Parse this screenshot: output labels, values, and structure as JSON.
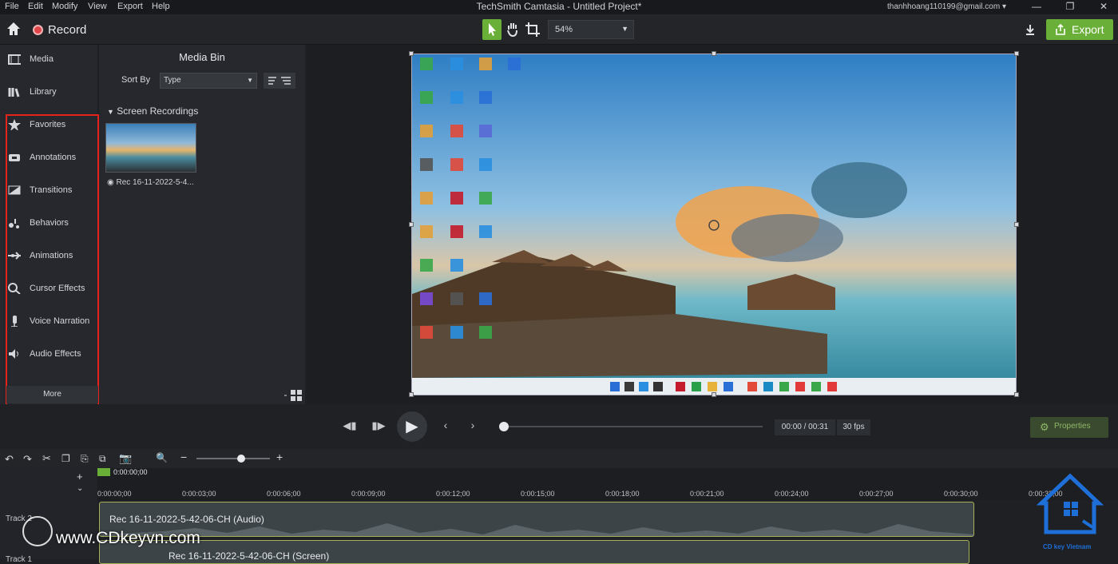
{
  "menubar": {
    "items": [
      "File",
      "Edit",
      "Modify",
      "View",
      "Export",
      "Help"
    ],
    "window_title": "TechSmith Camtasia - Untitled Project*",
    "account": "thanhhoang110199@gmail.com ▾"
  },
  "toolbar": {
    "record_label": "Record",
    "zoom_value": "54%",
    "export_label": "Export"
  },
  "leftnav": {
    "items": [
      {
        "label": "Media",
        "icon": "film-icon"
      },
      {
        "label": "Library",
        "icon": "library-icon"
      },
      {
        "label": "Favorites",
        "icon": "star-icon"
      },
      {
        "label": "Annotations",
        "icon": "annotation-icon"
      },
      {
        "label": "Transitions",
        "icon": "transition-icon"
      },
      {
        "label": "Behaviors",
        "icon": "behavior-icon"
      },
      {
        "label": "Animations",
        "icon": "animation-icon"
      },
      {
        "label": "Cursor Effects",
        "icon": "cursor-icon"
      },
      {
        "label": "Voice Narration",
        "icon": "microphone-icon"
      },
      {
        "label": "Audio Effects",
        "icon": "speaker-icon"
      }
    ],
    "more_label": "More",
    "highlight_color": "#e5231b"
  },
  "mediabin": {
    "title": "Media Bin",
    "sort_by_label": "Sort By",
    "sort_type": "Type",
    "section_label": "Screen Recordings",
    "clip_label": "Rec 16-11-2022-5-4..."
  },
  "playback": {
    "time": "00:00 / 00:31",
    "fps": "30 fps",
    "properties_label": "Properties",
    "progress": 0
  },
  "timeline": {
    "playhead_time": "0:00:00;00",
    "ticks": [
      "0:00:00;00",
      "0:00:03;00",
      "0:00:06;00",
      "0:00:09;00",
      "0:00:12;00",
      "0:00:15;00",
      "0:00:18;00",
      "0:00:21;00",
      "0:00:24;00",
      "0:00:27;00",
      "0:00:30;00",
      "0:00:33;00"
    ],
    "tracks": [
      {
        "name": "Track 2",
        "clip": "Rec 16-11-2022-5-42-06-CH (Audio)"
      },
      {
        "name": "Track 1",
        "clip": "Rec 16-11-2022-5-42-06-CH (Screen)"
      }
    ]
  },
  "watermark": {
    "url": "www.CDkeyvn.com",
    "logo_caption": "CD key Vietnam"
  },
  "colors": {
    "accent": "#6ab038",
    "background": "#1e2024"
  }
}
